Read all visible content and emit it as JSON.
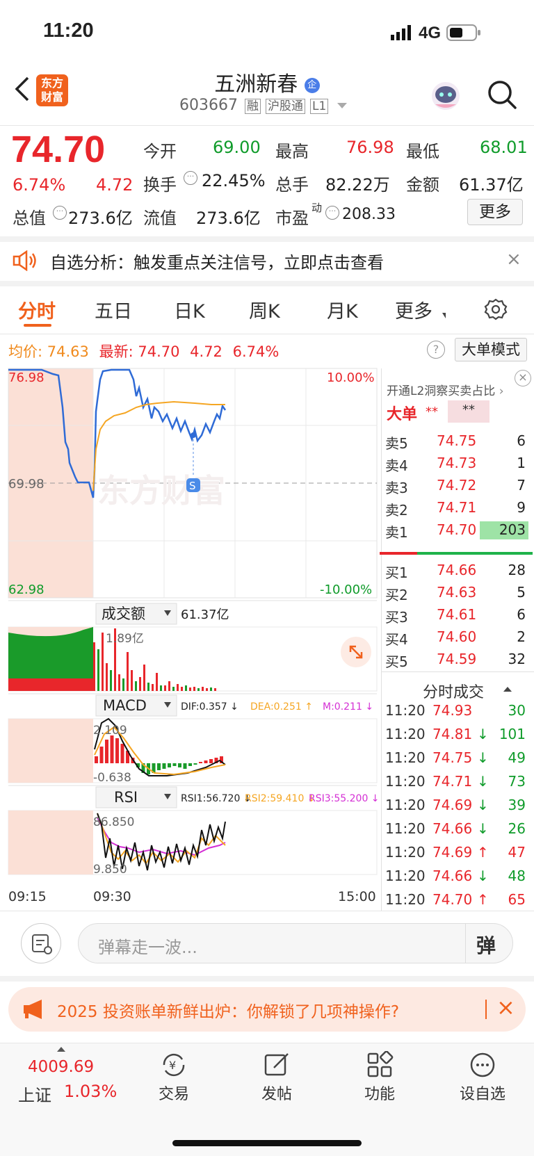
{
  "status_bar": {
    "time": "11:20",
    "network": "4G"
  },
  "header": {
    "logo_line1": "东方",
    "logo_line2": "财富",
    "stock_name": "五洲新春",
    "enterprise_badge": "企",
    "code": "603667",
    "tags": [
      "融",
      "沪股通",
      "L1"
    ]
  },
  "quote": {
    "price": "74.70",
    "change_pct": "6.74%",
    "change": "4.72",
    "open_label": "今开",
    "open": "69.00",
    "high_label": "最高",
    "high": "76.98",
    "low_label": "最低",
    "low": "68.01",
    "turnover_label": "换手",
    "turnover": "22.45%",
    "volume_label": "总手",
    "volume": "82.22万",
    "amount_label": "金额",
    "amount": "61.37亿",
    "mktcap_label": "总值",
    "mktcap": "273.6亿",
    "float_label": "流值",
    "float_cap": "273.6亿",
    "pe_label": "市盈",
    "pe_sup": "动",
    "pe": "208.33",
    "more_button": "更多"
  },
  "notice": {
    "text": "自选分析：触发重点关注信号，立即点击查看"
  },
  "tabs": [
    "分时",
    "五日",
    "日K",
    "周K",
    "月K",
    "更多"
  ],
  "chart_header": {
    "avg_label": "均价:",
    "avg": "74.63",
    "latest_label": "最新:",
    "latest": "74.70",
    "change": "4.72",
    "change_pct": "6.74%",
    "mode_button": "大单模式"
  },
  "chart_labels": {
    "y_top": "76.98",
    "y_mid": "69.98",
    "y_bottom": "62.98",
    "pct_top": "10.00%",
    "pct_bottom": "-10.00%",
    "watermark": "东方财富",
    "marker": "S"
  },
  "volume_panel": {
    "selector": "成交额",
    "total": "61.37亿",
    "max": "1.89亿"
  },
  "macd_panel": {
    "selector": "MACD",
    "dif": "DIF:0.357 ↓",
    "dea": "DEA:0.251 ↑",
    "m": "M:0.211 ↓",
    "max": "2.109",
    "min": "-0.638"
  },
  "rsi_panel": {
    "selector": "RSI",
    "rsi1": "RSI1:56.720 ↓",
    "rsi2": "RSI2:59.410 ↓",
    "rsi3": "RSI3:55.200 ↓",
    "max": "86.850",
    "min": "9.850"
  },
  "time_axis": [
    "09:15",
    "09:30",
    "15:00"
  ],
  "orderbook": {
    "banner": "开通L2洞察买卖占比",
    "big_order_label": "大单",
    "big_order_val1": "**",
    "big_order_val2": "**",
    "asks": [
      {
        "label": "卖5",
        "price": "74.75",
        "vol": "6"
      },
      {
        "label": "卖4",
        "price": "74.73",
        "vol": "1"
      },
      {
        "label": "卖3",
        "price": "74.72",
        "vol": "7"
      },
      {
        "label": "卖2",
        "price": "74.71",
        "vol": "9"
      },
      {
        "label": "卖1",
        "price": "74.70",
        "vol": "203"
      }
    ],
    "bids": [
      {
        "label": "买1",
        "price": "74.66",
        "vol": "28"
      },
      {
        "label": "买2",
        "price": "74.63",
        "vol": "5"
      },
      {
        "label": "买3",
        "price": "74.61",
        "vol": "6"
      },
      {
        "label": "买4",
        "price": "74.60",
        "vol": "2"
      },
      {
        "label": "买5",
        "price": "74.59",
        "vol": "32"
      }
    ]
  },
  "ticks": {
    "title": "分时成交",
    "rows": [
      {
        "time": "11:20",
        "price": "74.93",
        "dir": "",
        "vol": "30"
      },
      {
        "time": "11:20",
        "price": "74.81",
        "dir": "↓",
        "vol": "101"
      },
      {
        "time": "11:20",
        "price": "74.75",
        "dir": "↓",
        "vol": "49"
      },
      {
        "time": "11:20",
        "price": "74.71",
        "dir": "↓",
        "vol": "73"
      },
      {
        "time": "11:20",
        "price": "74.69",
        "dir": "↓",
        "vol": "39"
      },
      {
        "time": "11:20",
        "price": "74.66",
        "dir": "↓",
        "vol": "26"
      },
      {
        "time": "11:20",
        "price": "74.69",
        "dir": "↑",
        "vol": "47"
      },
      {
        "time": "11:20",
        "price": "74.66",
        "dir": "↓",
        "vol": "48"
      },
      {
        "time": "11:20",
        "price": "74.70",
        "dir": "↑",
        "vol": "65"
      }
    ]
  },
  "comment": {
    "placeholder": "弹幕走一波...",
    "button": "弹"
  },
  "promo": {
    "text": "2025 投资账单新鲜出炉：你解锁了几项神操作?"
  },
  "bottom_nav": {
    "index_value": "4009.69",
    "index_name": "上证",
    "index_change": "1.03%",
    "items": [
      "交易",
      "发帖",
      "功能",
      "设自选"
    ]
  },
  "colors": {
    "up": "#e8262b",
    "down": "#0f9b2a",
    "accent": "#f0611d",
    "price_line": "#2f6bd6",
    "avg_line": "#f5a623"
  }
}
